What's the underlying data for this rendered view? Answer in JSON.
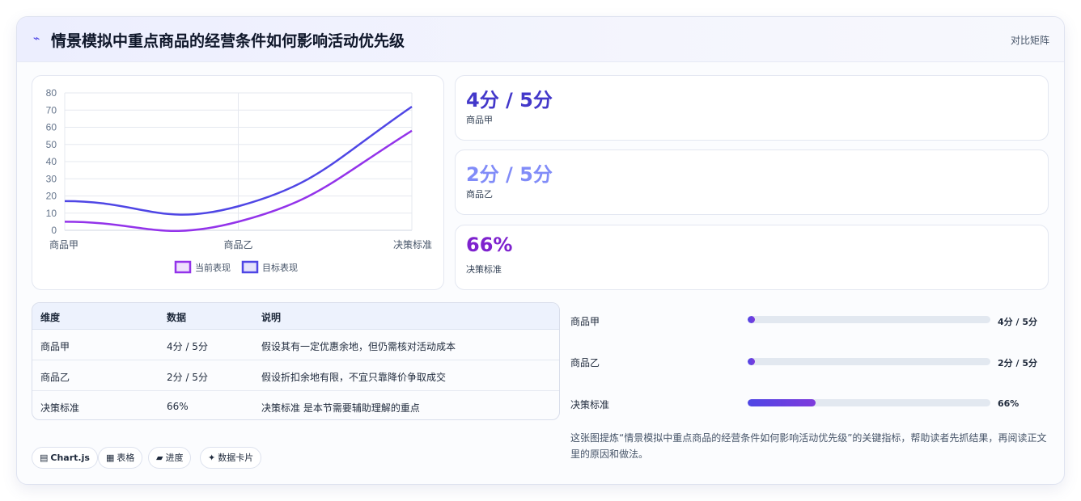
{
  "header": {
    "icon": "chart-line-icon",
    "icon_glyph": "⌁",
    "title": "情景模拟中重点商品的经营条件如何影响活动优先级",
    "tag": "对比矩阵"
  },
  "chart_data": {
    "type": "line",
    "categories": [
      "商品甲",
      "商品乙",
      "决策标准"
    ],
    "ylim": [
      0,
      80
    ],
    "yticks": [
      0,
      10,
      20,
      30,
      40,
      50,
      60,
      70,
      80
    ],
    "grid": true,
    "legend_position": "bottom",
    "series": [
      {
        "name": "当前表现",
        "values": [
          5,
          5,
          58
        ],
        "color": "#9333ea"
      },
      {
        "name": "目标表现",
        "values": [
          17,
          14,
          72
        ],
        "color": "#4f46e5"
      }
    ]
  },
  "stats": [
    {
      "value": "4分 / 5分",
      "label": "商品甲",
      "color": "#4338ca"
    },
    {
      "value": "2分 / 5分",
      "label": "商品乙",
      "color": "#818cf8"
    },
    {
      "value": "66%",
      "label": "决策标准",
      "color": "#7e22ce"
    }
  ],
  "table": {
    "headers": [
      "维度",
      "数据",
      "说明"
    ],
    "rows": [
      [
        "商品甲",
        "4分 / 5分",
        "假设其有一定优惠余地，但仍需核对活动成本"
      ],
      [
        "商品乙",
        "2分 / 5分",
        "假设折扣余地有限，不宜只靠降价争取成交"
      ],
      [
        "决策标准",
        "66%",
        "决策标准 是本节需要辅助理解的重点"
      ]
    ]
  },
  "pills": [
    {
      "icon": "table-icon",
      "glyph": "▤",
      "label": "Chart.js"
    },
    {
      "icon": "grid-icon",
      "glyph": "▦",
      "label": "表格"
    },
    {
      "icon": "progress-icon",
      "glyph": "▰",
      "label": "进度"
    },
    {
      "icon": "sparkle-icon",
      "glyph": "✦",
      "label": "数据卡片"
    }
  ],
  "progress": [
    {
      "label": "商品甲",
      "value": "4分 / 5分",
      "fraction": 0.02
    },
    {
      "label": "商品乙",
      "value": "2分 / 5分",
      "fraction": 0.02
    },
    {
      "label": "决策标准",
      "value": "66%",
      "fraction": 0.28
    }
  ],
  "note": "这张图提炼“情景模拟中重点商品的经营条件如何影响活动优先级”的关键指标，帮助读者先抓结果，再阅读正文里的原因和做法。"
}
